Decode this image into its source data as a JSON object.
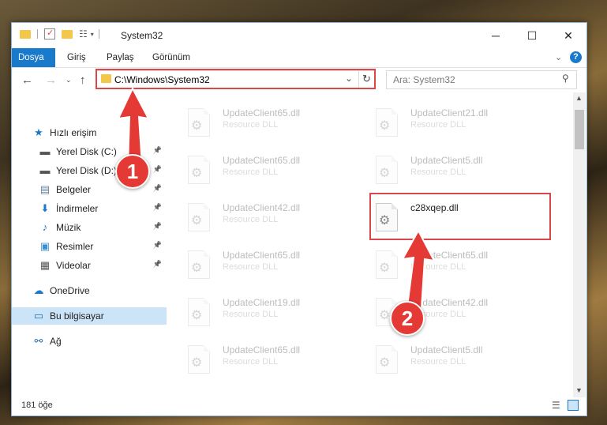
{
  "window": {
    "title": "System32"
  },
  "ribbon": {
    "tabs": [
      {
        "label": "Dosya"
      },
      {
        "label": "Giriş"
      },
      {
        "label": "Paylaş"
      },
      {
        "label": "Görünüm"
      }
    ]
  },
  "address": {
    "path": "C:\\Windows\\System32"
  },
  "search": {
    "placeholder": "Ara: System32"
  },
  "nav": {
    "items": [
      {
        "label": "Hızlı erişim",
        "icon": "star-icon"
      },
      {
        "label": "Yerel Disk (C:)",
        "icon": "drive-icon",
        "pinned": true
      },
      {
        "label": "Yerel Disk (D:)",
        "icon": "drive-icon",
        "pinned": true
      },
      {
        "label": "Belgeler",
        "icon": "documents-icon",
        "pinned": true
      },
      {
        "label": "İndirmeler",
        "icon": "download-icon",
        "pinned": true
      },
      {
        "label": "Müzik",
        "icon": "music-icon",
        "pinned": true
      },
      {
        "label": "Resimler",
        "icon": "pictures-icon",
        "pinned": true
      },
      {
        "label": "Videolar",
        "icon": "videos-icon",
        "pinned": true
      },
      {
        "label": "OneDrive",
        "icon": "onedrive-icon"
      },
      {
        "label": "Bu bilgisayar",
        "icon": "computer-icon",
        "selected": true
      },
      {
        "label": "Ağ",
        "icon": "network-icon"
      }
    ]
  },
  "files": [
    {
      "name": "UpdateClient65.dll",
      "desc": "Resource DLL",
      "dim": true
    },
    {
      "name": "UpdateClient21.dll",
      "desc": "Resource DLL",
      "dim": true
    },
    {
      "name": "UpdateClient65.dll",
      "desc": "Resource DLL",
      "dim": true
    },
    {
      "name": "UpdateClient5.dll",
      "desc": "Resource DLL",
      "dim": true
    },
    {
      "name": "UpdateClient42.dll",
      "desc": "Resource DLL",
      "dim": true
    },
    {
      "name": "c28xqep.dll",
      "desc": "",
      "dim": false
    },
    {
      "name": "UpdateClient65.dll",
      "desc": "Resource DLL",
      "dim": true
    },
    {
      "name": "UpdateClient65.dll",
      "desc": "Resource DLL",
      "dim": true
    },
    {
      "name": "UpdateClient19.dll",
      "desc": "Resource DLL",
      "dim": true
    },
    {
      "name": "UpdateClient42.dll",
      "desc": "Resource DLL",
      "dim": true
    },
    {
      "name": "UpdateClient65.dll",
      "desc": "Resource DLL",
      "dim": true
    },
    {
      "name": "UpdateClient5.dll",
      "desc": "Resource DLL",
      "dim": true
    }
  ],
  "status": {
    "count": "181 öğe"
  },
  "annotations": {
    "step1": "1",
    "step2": "2",
    "color": "#e53935"
  }
}
